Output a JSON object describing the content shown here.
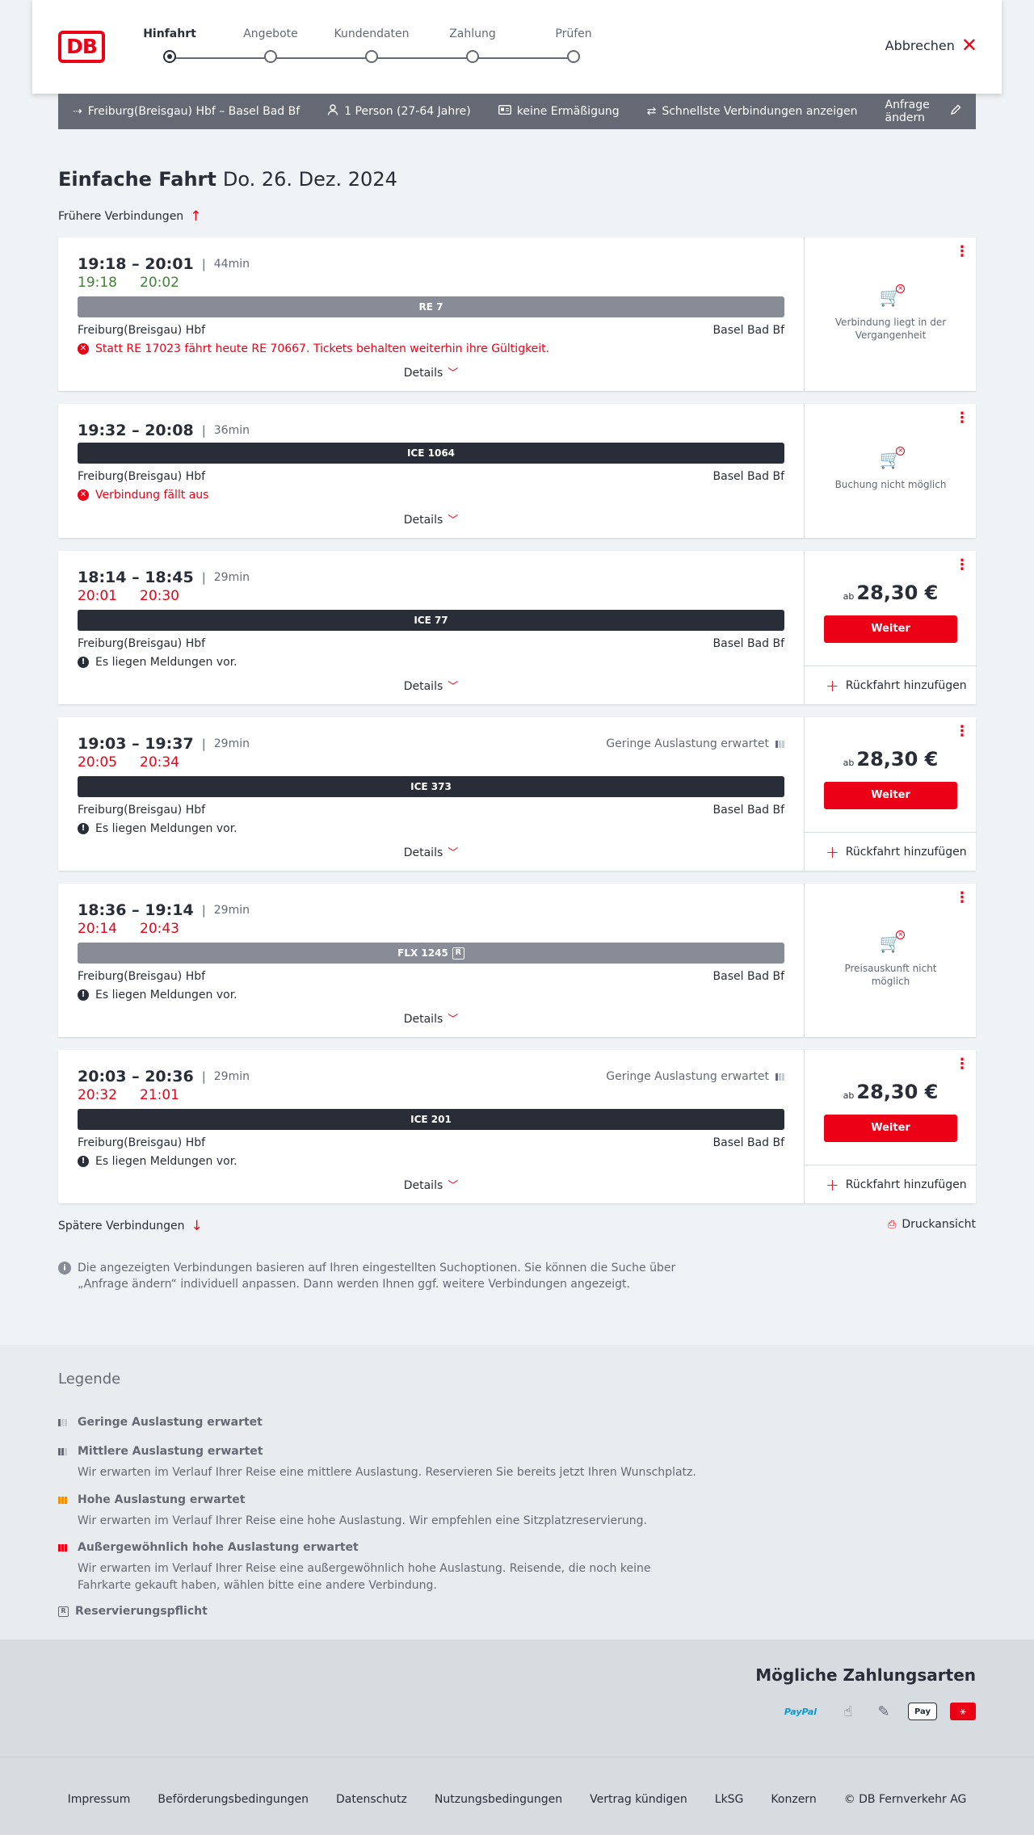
{
  "header": {
    "logo": "DB",
    "steps": [
      "Hinfahrt",
      "Angebote",
      "Kundendaten",
      "Zahlung",
      "Prüfen"
    ],
    "active_step": 0,
    "cancel_label": "Abbrechen"
  },
  "searchbar": {
    "route": "Freiburg(Breisgau) Hbf – Basel Bad Bf",
    "passengers": "1 Person (27-64 Jahre)",
    "discount": "keine Ermäßigung",
    "fastest": "Schnellste Verbindungen anzeigen",
    "change": "Anfrage ändern"
  },
  "title": {
    "type": "Einfache Fahrt",
    "date": "Do. 26. Dez. 2024"
  },
  "earlier_label": "Frühere Verbindungen",
  "later_label": "Spätere Verbindungen",
  "print_label": "Druckansicht",
  "connections": [
    {
      "times": "19:18 – 20:01",
      "duration": "44min",
      "realtime": [
        "19:18",
        "20:02"
      ],
      "realtime_color": "green",
      "train": "RE 7",
      "train_style": "grey",
      "from": "Freiburg(Breisgau) Hbf",
      "to": "Basel Bad Bf",
      "message": "Statt RE 17023 fährt heute RE 70667. Tickets behalten weiterhin ihre Gültigkeit.",
      "message_type": "red",
      "details": "Details",
      "side_text": "Verbindung liegt in der Vergangenheit"
    },
    {
      "times": "19:32 – 20:08",
      "duration": "36min",
      "train": "ICE 1064",
      "train_style": "dark",
      "from": "Freiburg(Breisgau) Hbf",
      "to": "Basel Bad Bf",
      "message": "Verbindung fällt aus",
      "message_type": "red",
      "details": "Details",
      "side_text": "Buchung nicht möglich"
    },
    {
      "times": "18:14 – 18:45",
      "duration": "29min",
      "realtime": [
        "20:01",
        "20:30"
      ],
      "realtime_color": "red",
      "train": "ICE 77",
      "train_style": "dark",
      "from": "Freiburg(Breisgau) Hbf",
      "to": "Basel Bad Bf",
      "message": "Es liegen Meldungen vor.",
      "message_type": "black",
      "details": "Details",
      "price_prefix": "ab",
      "price": "28,30 €",
      "button": "Weiter",
      "return": "Rückfahrt hinzufügen"
    },
    {
      "times": "19:03 – 19:37",
      "duration": "29min",
      "occupancy": "Geringe Auslastung erwartet",
      "realtime": [
        "20:05",
        "20:34"
      ],
      "realtime_color": "red",
      "train": "ICE 373",
      "train_style": "dark",
      "from": "Freiburg(Breisgau) Hbf",
      "to": "Basel Bad Bf",
      "message": "Es liegen Meldungen vor.",
      "message_type": "black",
      "details": "Details",
      "price_prefix": "ab",
      "price": "28,30 €",
      "button": "Weiter",
      "return": "Rückfahrt hinzufügen"
    },
    {
      "times": "18:36 – 19:14",
      "duration": "29min",
      "realtime": [
        "20:14",
        "20:43"
      ],
      "realtime_color": "red",
      "train": "FLX 1245",
      "train_style": "grey",
      "reservation_badge": "R",
      "from": "Freiburg(Breisgau) Hbf",
      "to": "Basel Bad Bf",
      "message": "Es liegen Meldungen vor.",
      "message_type": "black",
      "details": "Details",
      "side_text": "Preisauskunft nicht möglich"
    },
    {
      "times": "20:03 – 20:36",
      "duration": "29min",
      "occupancy": "Geringe Auslastung erwartet",
      "realtime": [
        "20:32",
        "21:01"
      ],
      "realtime_color": "red",
      "train": "ICE 201",
      "train_style": "dark",
      "from": "Freiburg(Breisgau) Hbf",
      "to": "Basel Bad Bf",
      "message": "Es liegen Meldungen vor.",
      "message_type": "black",
      "details": "Details",
      "price_prefix": "ab",
      "price": "28,30 €",
      "button": "Weiter",
      "return": "Rückfahrt hinzufügen"
    }
  ],
  "info_text": "Die angezeigten Verbindungen basieren auf Ihren eingestellten Suchoptionen. Sie können die Suche über „Anfrage ändern“ individuell anpassen. Dann werden Ihnen ggf. weitere Verbindungen angezeigt.",
  "legend": {
    "title": "Legende",
    "items": [
      {
        "label": "Geringe Auslastung erwartet",
        "desc": ""
      },
      {
        "label": "Mittlere Auslastung erwartet",
        "desc": "Wir erwarten im Verlauf Ihrer Reise eine mittlere Auslastung. Reservieren Sie bereits jetzt Ihren Wunschplatz."
      },
      {
        "label": "Hohe Auslastung erwartet",
        "desc": "Wir erwarten im Verlauf Ihrer Reise eine hohe Auslastung. Wir empfehlen eine Sitzplatzreservierung."
      },
      {
        "label": "Außergewöhnlich hohe Auslastung erwartet",
        "desc": "Wir erwarten im Verlauf Ihrer Reise eine außergewöhnlich hohe Auslastung. Reisende, die noch keine Fahrkarte gekauft haben, wählen bitte eine andere Verbindung."
      },
      {
        "label": "Reservierungspflicht",
        "desc": ""
      }
    ]
  },
  "payment": {
    "title": "Mögliche Zahlungsarten",
    "methods": [
      "PayPal",
      "Pay"
    ]
  },
  "footer": {
    "links": [
      "Impressum",
      "Beförderungsbedingungen",
      "Datenschutz",
      "Nutzungsbedingungen",
      "Vertrag kündigen",
      "LkSG",
      "Konzern",
      "© DB Fernverkehr AG"
    ]
  },
  "colors": {
    "brand": "#ec0016",
    "dark": "#282d37",
    "realtime_ok": "#408335"
  }
}
